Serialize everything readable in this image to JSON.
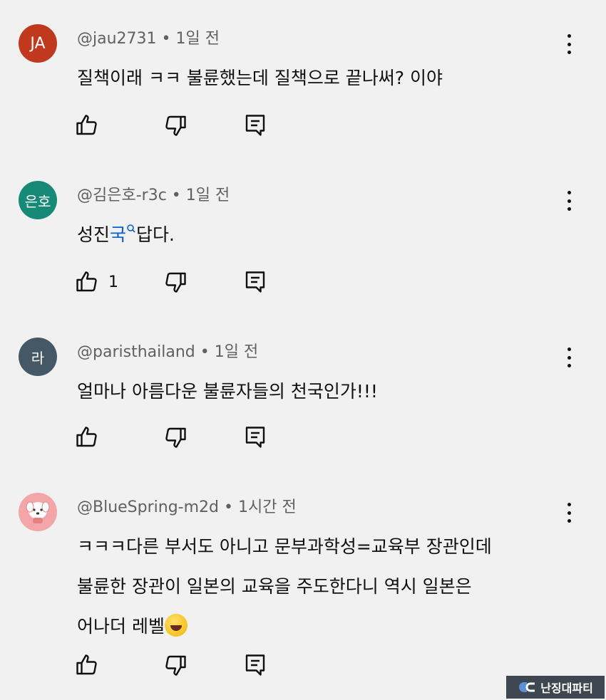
{
  "comments": [
    {
      "initials": "JA",
      "avatar_color": "#c0391f",
      "author": "@jau2731",
      "time": "1일 전",
      "text": "질책이래 ㅋㅋ 불륜했는데 질책으로 끝나써? 이야",
      "likes": ""
    },
    {
      "initials": "은호",
      "avatar_color": "#168a76",
      "author": "@김은호-r3c",
      "time": "1일 전",
      "text_before": "성진",
      "text_link": "국",
      "text_after": "답다.",
      "likes": "1"
    },
    {
      "initials": "라",
      "avatar_color": "#455866",
      "author": "@paristhailand",
      "time": "1일 전",
      "text": "얼마나 아름다운 불륜자들의 천국인가!!!",
      "likes": ""
    },
    {
      "initials": "",
      "avatar_color": "#f4a5a8",
      "author": "@BlueSpring-m2d",
      "time": "1시간 전",
      "lines": [
        "ㅋㅋㅋ다른 부서도 아니고 문부과학성=교육부 장관인데",
        "불륜한 장관이 일본의 교육을 주도한다니 역시 일본은",
        "어나더 레벨"
      ],
      "likes": ""
    }
  ],
  "separator": "•",
  "watermark": "난징대파티"
}
